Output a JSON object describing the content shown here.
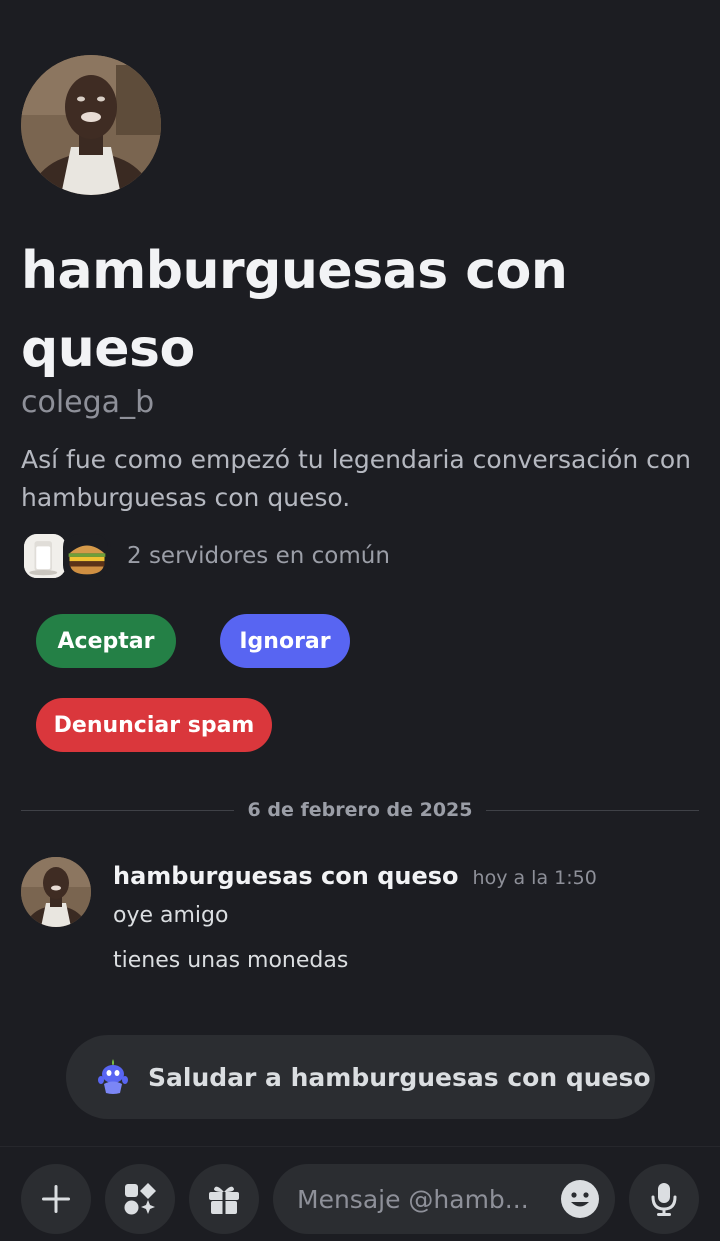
{
  "profile": {
    "display_name": "hamburguesas con queso",
    "username": "colega_b",
    "intro_text": "Así fue como empezó tu legendaria conversación con hamburguesas con queso.",
    "mutual_servers_text": "2 servidores en común",
    "avatar_icon": "user-photo-avatar"
  },
  "actions": {
    "accept_label": "Aceptar",
    "ignore_label": "Ignorar",
    "spam_label": "Denunciar spam"
  },
  "divider": {
    "date": "6 de febrero de 2025"
  },
  "message": {
    "author": "hamburguesas con queso",
    "timestamp": "hoy a la 1:50",
    "lines": [
      "oye amigo",
      "tienes unas monedas"
    ]
  },
  "wave": {
    "label": "Saludar a hamburguesas con queso",
    "icon": "wumpus-wave-icon"
  },
  "composer": {
    "placeholder": "Mensaje @hamb...",
    "icons": [
      "plus-icon",
      "apps-icon",
      "gift-icon",
      "emoji-icon",
      "microphone-icon"
    ]
  },
  "colors": {
    "background": "#1c1d22",
    "accept": "#248046",
    "ignore": "#5865f2",
    "spam": "#da373c",
    "input_bg": "#2b2d31"
  }
}
